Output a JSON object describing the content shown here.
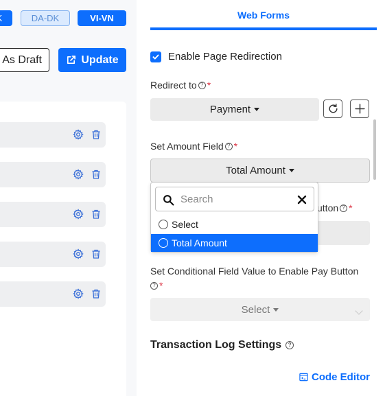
{
  "colors": {
    "accent": "#0d6efd",
    "required": "#dc3545"
  },
  "languages": [
    {
      "label": "K",
      "active": true
    },
    {
      "label": "DA-DK",
      "active": false
    },
    {
      "label": "VI-VN",
      "active": true
    }
  ],
  "toolbar": {
    "draft_label": "As Draft",
    "update_label": "Update",
    "update_icon": "external-link-icon"
  },
  "list_rows": [
    {
      "icons": [
        "gear-icon",
        "trash-icon"
      ]
    },
    {
      "icons": [
        "gear-icon",
        "trash-icon"
      ]
    },
    {
      "icons": [
        "gear-icon",
        "trash-icon"
      ]
    },
    {
      "icons": [
        "gear-icon",
        "trash-icon"
      ]
    },
    {
      "icons": [
        "gear-icon",
        "trash-icon"
      ]
    }
  ],
  "tab": {
    "label": "Web Forms"
  },
  "redirection": {
    "checkbox_label": "Enable Page Redirection",
    "checked": true,
    "redirect_label": "Redirect to",
    "redirect_value": "Payment"
  },
  "amount": {
    "label": "Set Amount Field",
    "value": "Total Amount"
  },
  "dropdown": {
    "search_placeholder": "Search",
    "options": [
      {
        "label": "Select",
        "selected": false
      },
      {
        "label": "Total Amount",
        "selected": true
      }
    ]
  },
  "obscured_label_tail": "utton",
  "conditional": {
    "label": "Set Conditional Field Value to Enable Pay Button",
    "value": "Select"
  },
  "transaction_log": {
    "title": "Transaction Log Settings"
  },
  "code_editor": {
    "label": "Code Editor"
  },
  "required_marker": "*",
  "help_glyph": "?"
}
